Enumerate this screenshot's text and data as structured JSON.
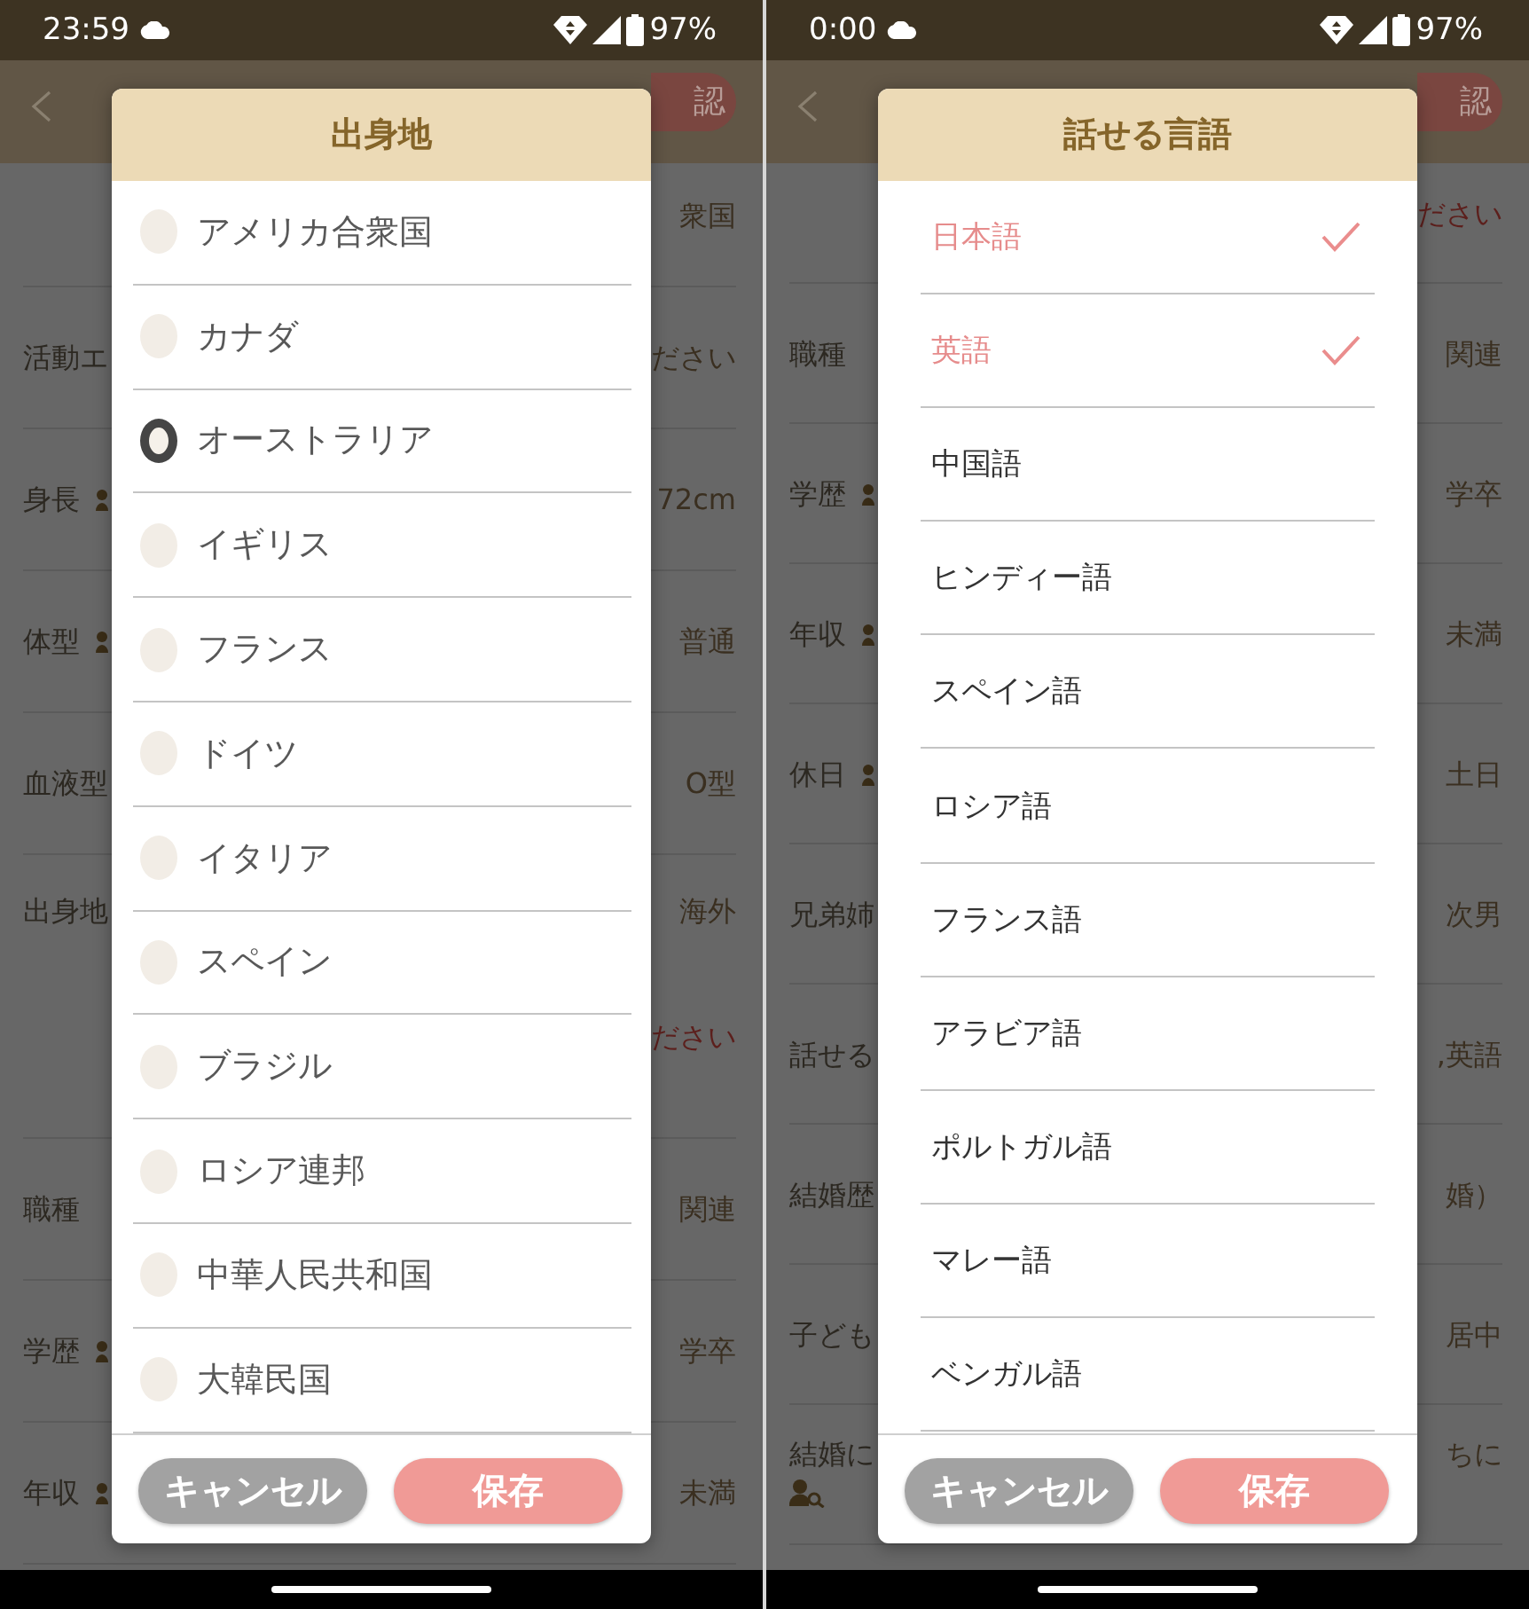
{
  "screens": [
    {
      "status_bar": {
        "time": "23:59",
        "battery": "97%"
      },
      "header": {
        "action_button": "認"
      },
      "rows": [
        {
          "kind": "plain",
          "values": [
            {
              "text": "衆国",
              "kind": "answer"
            }
          ]
        },
        {
          "kind": "plain",
          "label": "活動エ",
          "values": [
            {
              "text": "ださい",
              "kind": "answer"
            }
          ]
        },
        {
          "kind": "person",
          "label": "身長",
          "values": [
            {
              "text": "72cm",
              "kind": "answer"
            }
          ]
        },
        {
          "kind": "person",
          "label": "体型",
          "values": [
            {
              "text": "普通",
              "kind": "answer"
            }
          ]
        },
        {
          "kind": "plain",
          "label": "血液型",
          "values": [
            {
              "text": "O型",
              "kind": "answer"
            }
          ]
        },
        {
          "kind": "plain",
          "label": "出身地",
          "values": [
            {
              "text": "海外",
              "kind": "answer"
            },
            {
              "text": "ださい",
              "kind": "prompt"
            }
          ]
        },
        {
          "kind": "plain",
          "label": "職種",
          "values": [
            {
              "text": "関連",
              "kind": "answer"
            }
          ]
        },
        {
          "kind": "person",
          "label": "学歴",
          "values": [
            {
              "text": "学卒",
              "kind": "answer"
            }
          ]
        },
        {
          "kind": "person",
          "label": "年収",
          "values": [
            {
              "text": "未満",
              "kind": "answer"
            }
          ]
        }
      ],
      "dialog": {
        "title": "出身地",
        "kind": "radio",
        "options": [
          {
            "label": "アメリカ合衆国",
            "selected": false
          },
          {
            "label": "カナダ",
            "selected": false
          },
          {
            "label": "オーストラリア",
            "selected": true
          },
          {
            "label": "イギリス",
            "selected": false
          },
          {
            "label": "フランス",
            "selected": false
          },
          {
            "label": "ドイツ",
            "selected": false
          },
          {
            "label": "イタリア",
            "selected": false
          },
          {
            "label": "スペイン",
            "selected": false
          },
          {
            "label": "ブラジル",
            "selected": false
          },
          {
            "label": "ロシア連邦",
            "selected": false
          },
          {
            "label": "中華人民共和国",
            "selected": false
          },
          {
            "label": "大韓民国",
            "selected": false
          }
        ],
        "buttons": [
          {
            "label": "キャンセル",
            "kind": "cancel"
          },
          {
            "label": "保存",
            "kind": "save"
          }
        ]
      }
    },
    {
      "status_bar": {
        "time": "0:00",
        "battery": "97%"
      },
      "header": {
        "action_button": "認"
      },
      "rows": [
        {
          "kind": "plain",
          "values": [
            {
              "text": "ださい",
              "kind": "prompt"
            }
          ]
        },
        {
          "kind": "plain",
          "label": "職種",
          "values": [
            {
              "text": "関連",
              "kind": "answer"
            }
          ]
        },
        {
          "kind": "person",
          "label": "学歴",
          "values": [
            {
              "text": "学卒",
              "kind": "answer"
            }
          ]
        },
        {
          "kind": "person",
          "label": "年収",
          "values": [
            {
              "text": "未満",
              "kind": "answer"
            }
          ]
        },
        {
          "kind": "person",
          "label": "休日",
          "values": [
            {
              "text": "土日",
              "kind": "answer"
            }
          ]
        },
        {
          "kind": "plain",
          "label": "兄弟姉",
          "values": [
            {
              "text": "次男",
              "kind": "answer"
            }
          ]
        },
        {
          "kind": "plain",
          "label": "話せる",
          "values": [
            {
              "text": ",英語",
              "kind": "answer"
            }
          ]
        },
        {
          "kind": "plain",
          "label": "結婚歴",
          "values": [
            {
              "text": "婚）",
              "kind": "answer"
            }
          ]
        },
        {
          "kind": "plain",
          "label": "子ども",
          "values": [
            {
              "text": "居中",
              "kind": "answer"
            }
          ]
        },
        {
          "kind": "search",
          "label": "結婚に",
          "values": [
            {
              "text": "ちに",
              "kind": "answer"
            }
          ]
        }
      ],
      "dialog": {
        "title": "話せる言語",
        "kind": "check",
        "options": [
          {
            "label": "日本語",
            "selected": true
          },
          {
            "label": "英語",
            "selected": true
          },
          {
            "label": "中国語",
            "selected": false
          },
          {
            "label": "ヒンディー語",
            "selected": false
          },
          {
            "label": "スペイン語",
            "selected": false
          },
          {
            "label": "ロシア語",
            "selected": false
          },
          {
            "label": "フランス語",
            "selected": false
          },
          {
            "label": "アラビア語",
            "selected": false
          },
          {
            "label": "ポルトガル語",
            "selected": false
          },
          {
            "label": "マレー語",
            "selected": false
          },
          {
            "label": "ベンガル語",
            "selected": false
          }
        ],
        "buttons": [
          {
            "label": "キャンセル",
            "kind": "cancel"
          },
          {
            "label": "保存",
            "kind": "save"
          }
        ]
      }
    }
  ]
}
